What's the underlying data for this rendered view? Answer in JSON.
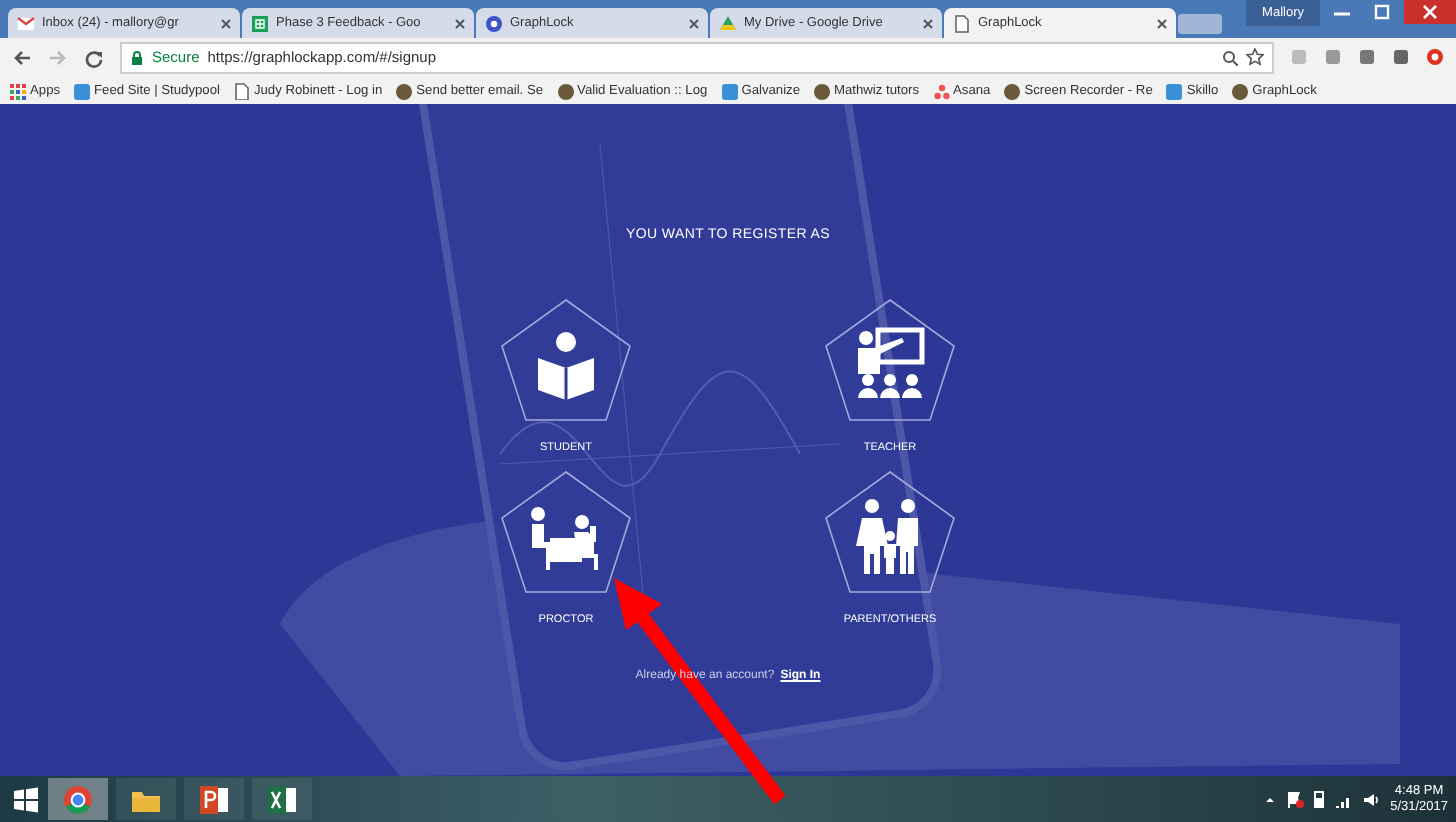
{
  "browser": {
    "tabs": [
      {
        "title": "Inbox (24) - mallory@gr",
        "selected": false
      },
      {
        "title": "Phase 3 Feedback - Goo",
        "selected": false
      },
      {
        "title": "GraphLock",
        "selected": false
      },
      {
        "title": "My Drive - Google Drive",
        "selected": false
      },
      {
        "title": "GraphLock",
        "selected": true
      }
    ],
    "profile": "Mallory",
    "security": "Secure",
    "url": "https://graphlockapp.com/#/signup",
    "bookmarks": [
      {
        "label": "Apps"
      },
      {
        "label": "Feed Site | Studypool"
      },
      {
        "label": "Judy Robinett - Log in"
      },
      {
        "label": "Send better email. Se"
      },
      {
        "label": "Valid Evaluation :: Log"
      },
      {
        "label": "Galvanize"
      },
      {
        "label": "Mathwiz tutors"
      },
      {
        "label": "Asana"
      },
      {
        "label": "Screen Recorder - Re"
      },
      {
        "label": "Skillo"
      },
      {
        "label": "GraphLock"
      }
    ]
  },
  "page": {
    "heading": "YOU WANT TO REGISTER AS",
    "roles": [
      {
        "label": "STUDENT",
        "kind": "student"
      },
      {
        "label": "TEACHER",
        "kind": "teacher"
      },
      {
        "label": "PROCTOR",
        "kind": "proctor"
      },
      {
        "label": "PARENT/OTHERS",
        "kind": "parent"
      }
    ],
    "signin_prompt": "Already have an account?",
    "signin_link": "Sign In"
  },
  "taskbar": {
    "apps": [
      {
        "kind": "chrome",
        "selected": true
      },
      {
        "kind": "explorer",
        "selected": false
      },
      {
        "kind": "powerpoint",
        "selected": false
      },
      {
        "kind": "excel",
        "selected": false
      }
    ],
    "time": "4:48 PM",
    "date": "5/31/2017"
  }
}
